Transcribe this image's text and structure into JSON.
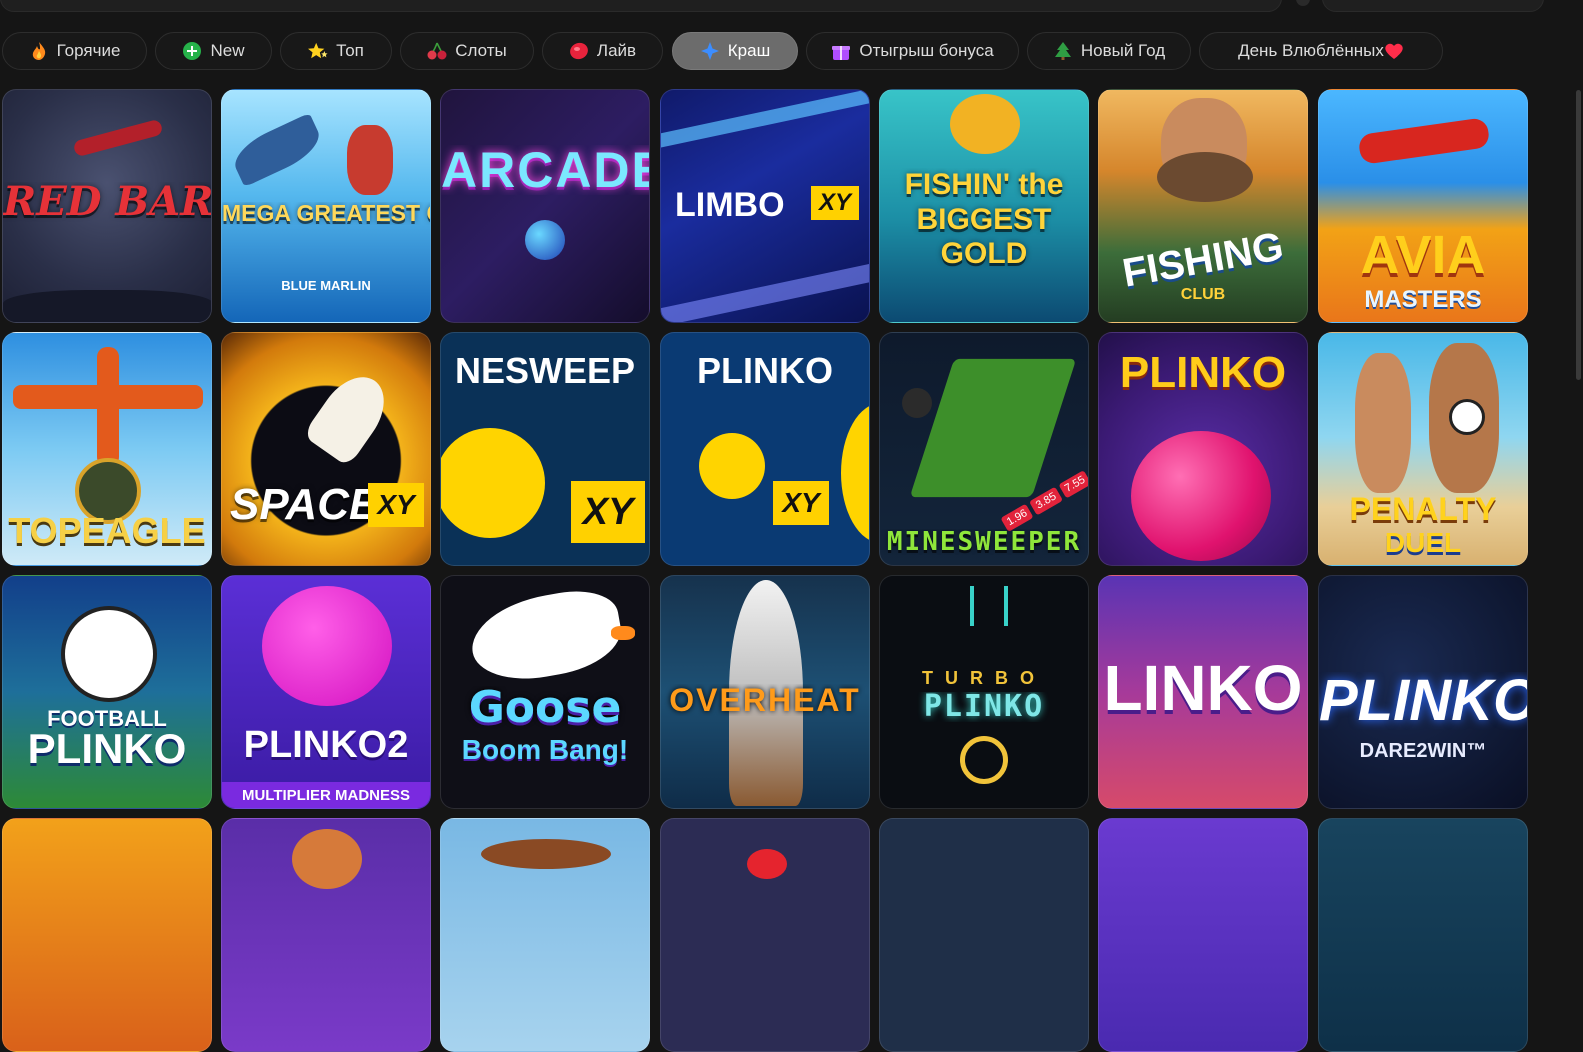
{
  "categories": [
    {
      "label": "Горячие",
      "icon": "flame-icon",
      "active": false
    },
    {
      "label": "New",
      "icon": "plus-circle-icon",
      "active": false
    },
    {
      "label": "Топ",
      "icon": "stars-icon",
      "active": false
    },
    {
      "label": "Слоты",
      "icon": "cherries-icon",
      "active": false
    },
    {
      "label": "Лайв",
      "icon": "chip-icon",
      "active": false
    },
    {
      "label": "Краш",
      "icon": "sparkle-icon",
      "active": true
    },
    {
      "label": "Отыгрыш бонуса",
      "icon": "gift-icon",
      "active": false
    },
    {
      "label": "Новый Год",
      "icon": "tree-icon",
      "active": false
    },
    {
      "label": "День Влюблённых",
      "icon": "heart-icon",
      "active": false
    }
  ],
  "games": {
    "red_baron": {
      "title": "RED BARON"
    },
    "mega_catch": {
      "title": "MEGA GREATEST CATCH",
      "sub": "BLUE MARLIN"
    },
    "arcade_bomb": {
      "title": "ARCADE BOMB"
    },
    "limbo": {
      "title": "LIMBO",
      "badge": "XY"
    },
    "fishin": {
      "title": "FISHIN' the BIGGEST GOLD"
    },
    "fishing_club": {
      "title": "FISHING",
      "sub": "CLUB"
    },
    "avia": {
      "title": "AVIA",
      "sub": "MASTERS"
    },
    "top_eagle": {
      "title": "TOPEAGLE"
    },
    "space_xy": {
      "title": "SPACE",
      "badge": "XY"
    },
    "minesweeper_xy": {
      "title": "NESWEEP",
      "badge": "XY"
    },
    "plinko_xy": {
      "title": "PLINKO",
      "badge": "XY"
    },
    "minesweeper": {
      "title": "MINESWEEPER",
      "multipliers": [
        "1.96",
        "3.85",
        "7.55"
      ]
    },
    "plinko_pink": {
      "title": "PLINKO"
    },
    "penalty": {
      "title": "PENALTY",
      "sub": "DUEL"
    },
    "football_plinko": {
      "title": "FOOTBALL",
      "sub": "PLINKO"
    },
    "plinko2": {
      "title": "PLINKO2",
      "sub": "MULTIPLIER MADNESS"
    },
    "goose": {
      "title": "Goose",
      "sub": "Boom Bang!"
    },
    "overheat": {
      "title": "OVERHEAT"
    },
    "turbo_plinko": {
      "title": "TURBO",
      "sub": "PLINKO"
    },
    "linko": {
      "title": "LINKO"
    },
    "plinko_dare": {
      "title": "PLINKO",
      "sub": "DARE2WIN™"
    }
  }
}
